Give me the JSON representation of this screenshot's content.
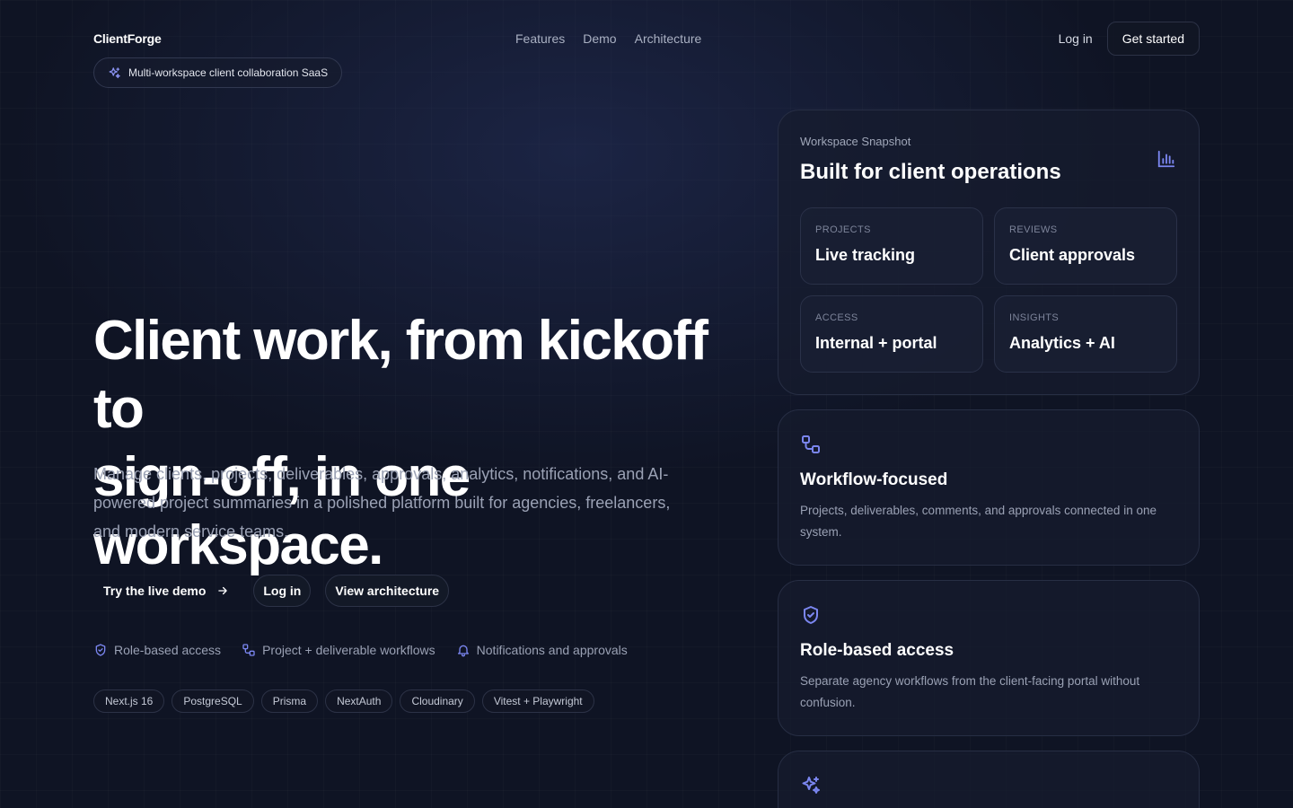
{
  "nav": {
    "brand": "ClientForge",
    "links": [
      "Features",
      "Demo",
      "Architecture"
    ],
    "login": "Log in",
    "get_started": "Get started"
  },
  "badge": {
    "label": "Multi-workspace client collaboration SaaS",
    "icon": "sparkles-icon"
  },
  "hero": {
    "title_line1": "Client work, from kickoff to",
    "title_line2": "sign-off, in one workspace.",
    "subtitle": "Manage clients, projects, deliverables, approvals, analytics, notifications, and AI-powered project summaries in a polished platform built for agencies, freelancers, and modern service teams.",
    "cta_demo": "Try the live demo",
    "cta_login": "Log in",
    "cta_architecture": "View architecture"
  },
  "features": [
    {
      "label": "Role-based access",
      "icon": "shield-check-icon"
    },
    {
      "label": "Project + deliverable workflows",
      "icon": "workflow-icon"
    },
    {
      "label": "Notifications and approvals",
      "icon": "bell-icon"
    }
  ],
  "tags": [
    "Next.js 16",
    "PostgreSQL",
    "Prisma",
    "NextAuth",
    "Cloudinary",
    "Vitest + Playwright"
  ],
  "snapshot": {
    "label": "Workspace Snapshot",
    "title": "Built for client operations",
    "icon": "bar-chart-icon",
    "stats": [
      {
        "label": "PROJECTS",
        "value": "Live tracking"
      },
      {
        "label": "REVIEWS",
        "value": "Client approvals"
      },
      {
        "label": "ACCESS",
        "value": "Internal + portal"
      },
      {
        "label": "INSIGHTS",
        "value": "Analytics + AI"
      }
    ]
  },
  "cards": [
    {
      "title": "Workflow-focused",
      "description": "Projects, deliverables, comments, and approvals connected in one system.",
      "icon": "workflow-icon"
    },
    {
      "title": "Role-based access",
      "description": "Separate agency workflows from the client-facing portal without confusion.",
      "icon": "shield-check-icon"
    },
    {
      "icon": "sparkles-icon"
    }
  ],
  "colors": {
    "accent": "#7b86f0",
    "background": "#0f1424",
    "panel": "#161c2e"
  }
}
